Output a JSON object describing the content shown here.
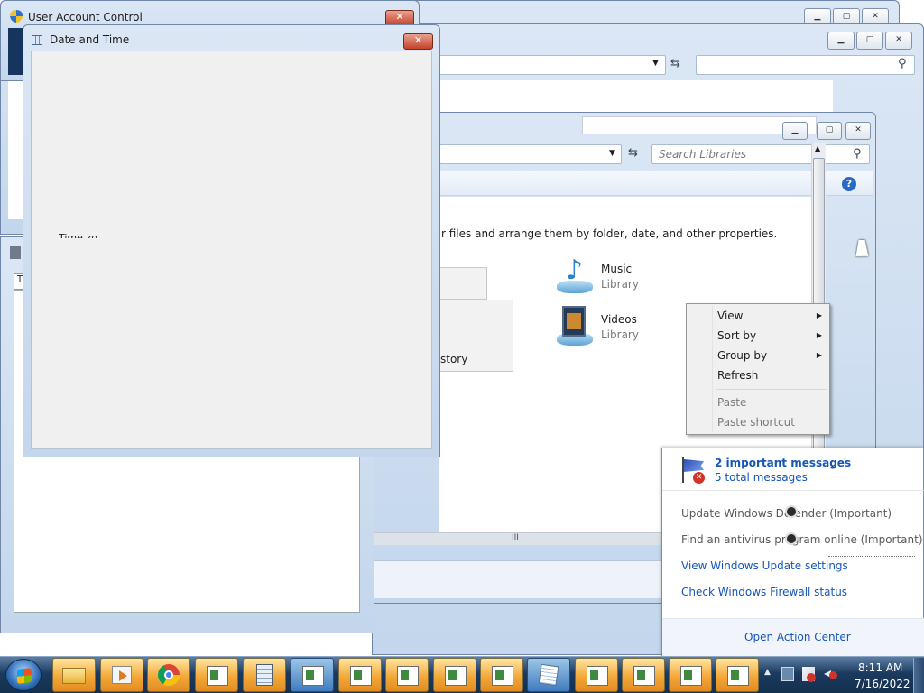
{
  "uac": {
    "title": "User Account Control"
  },
  "datetime": {
    "title": "Date and Time",
    "cut_label": "Time zo"
  },
  "libraries": {
    "search_placeholder": "Search Libraries",
    "description": "r files and arrange them by folder, date, and other properties.",
    "items": [
      {
        "name": "Music",
        "type": "Library"
      },
      {
        "name": "Videos",
        "type": "Library"
      }
    ],
    "history_fragment": "story",
    "scroll_glyph": "III"
  },
  "context_menu": {
    "items": [
      {
        "label": "View",
        "submenu": true,
        "enabled": true
      },
      {
        "label": "Sort by",
        "submenu": true,
        "enabled": true
      },
      {
        "label": "Group by",
        "submenu": true,
        "enabled": true
      },
      {
        "label": "Refresh",
        "submenu": false,
        "enabled": true
      },
      {
        "label": "Paste",
        "submenu": false,
        "enabled": false
      },
      {
        "label": "Paste shortcut",
        "submenu": false,
        "enabled": false
      }
    ]
  },
  "action_center": {
    "headline": "2 important messages",
    "subline": "5 total messages",
    "messages": [
      "Update Windows Defender (Important)",
      "Find an antivirus program online (Important)"
    ],
    "links": [
      "View Windows Update settings",
      "Check Windows Firewall status"
    ],
    "footer": "Open Action Center"
  },
  "taskbar": {
    "time": "8:11 AM",
    "date": "7/16/2022",
    "apps": [
      "start-orb",
      "explorer",
      "media-player",
      "chrome",
      "window",
      "calculator",
      "window",
      "window",
      "window",
      "window",
      "window",
      "notepad",
      "window",
      "window",
      "window",
      "window"
    ]
  },
  "colors": {
    "link": "#1556b8",
    "taskbar": "#1c3a5e",
    "accent": "#3f7bbf"
  }
}
